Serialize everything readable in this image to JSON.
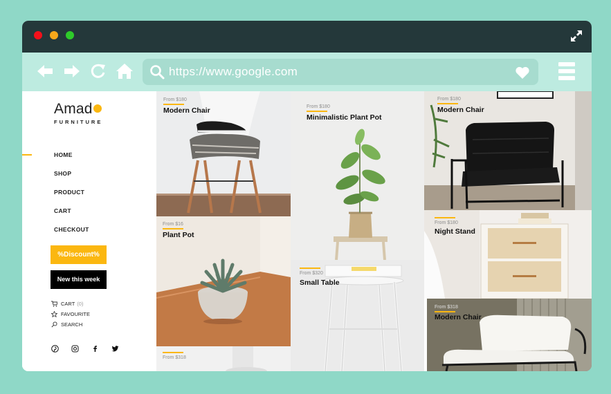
{
  "browser": {
    "url": "https://www.google.com"
  },
  "brand": {
    "name": "Amado",
    "name_main": "Amad",
    "tagline": "FURNITURE",
    "accent_color": "#fbb710"
  },
  "nav": {
    "items": [
      {
        "label": "HOME",
        "active": true
      },
      {
        "label": "SHOP"
      },
      {
        "label": "PRODUCT"
      },
      {
        "label": "CART"
      },
      {
        "label": "CHECKOUT"
      }
    ]
  },
  "buttons": {
    "discount": "%Discount%",
    "new_week": "New this week"
  },
  "quick": {
    "cart": "CART",
    "cart_count": "(0)",
    "favourite": "FAVOURITE",
    "search": "SEARCH"
  },
  "social": [
    "pinterest-icon",
    "instagram-icon",
    "facebook-icon",
    "twitter-icon"
  ],
  "products": [
    {
      "price": "From $180",
      "name": "Modern Chair"
    },
    {
      "price": "From $16",
      "name": "Plant Pot"
    },
    {
      "price": "From $318",
      "name": ""
    },
    {
      "price": "From $180",
      "name": "Minimalistic Plant Pot"
    },
    {
      "price": "From $320",
      "name": "Small Table"
    },
    {
      "price": "From $180",
      "name": "Modern Chair"
    },
    {
      "price": "From $180",
      "name": "Night Stand"
    },
    {
      "price": "From $318",
      "name": "Modern Chair"
    }
  ]
}
